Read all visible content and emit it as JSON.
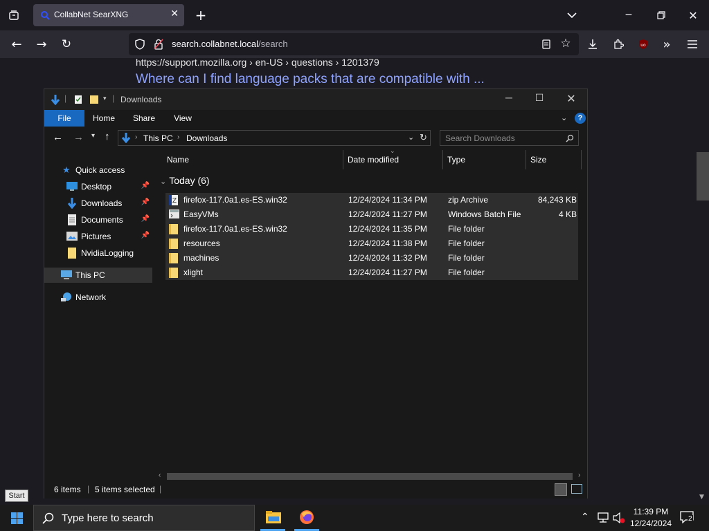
{
  "browser": {
    "tab_title": "CollabNet SearXNG",
    "url_host": "search.collabnet.local",
    "url_path": "/search"
  },
  "page": {
    "result_url": "https://support.mozilla.org  › en-US › questions › 1201379",
    "result_title": "Where can I find language packs that are compatible with ..."
  },
  "tooltip": {
    "start": "Start"
  },
  "explorer": {
    "title": "Downloads",
    "ribbon": {
      "file": "File",
      "home": "Home",
      "share": "Share",
      "view": "View"
    },
    "breadcrumb": {
      "this_pc": "This PC",
      "downloads": "Downloads"
    },
    "search_placeholder": "Search Downloads",
    "nav": {
      "quick_access": "Quick access",
      "desktop": "Desktop",
      "downloads": "Downloads",
      "documents": "Documents",
      "pictures": "Pictures",
      "nvidia": "NvidiaLogging",
      "this_pc": "This PC",
      "network": "Network"
    },
    "columns": {
      "name": "Name",
      "date": "Date modified",
      "type": "Type",
      "size": "Size"
    },
    "group": "Today (6)",
    "files": [
      {
        "name": "firefox-117.0a1.es-ES.win32",
        "date": "12/24/2024 11:34 PM",
        "type": "zip Archive",
        "size": "84,243 KB",
        "icon": "zip-icon"
      },
      {
        "name": "EasyVMs",
        "date": "12/24/2024 11:27 PM",
        "type": "Windows Batch File",
        "size": "4 KB",
        "icon": "batch-file-icon"
      },
      {
        "name": "firefox-117.0a1.es-ES.win32",
        "date": "12/24/2024 11:35 PM",
        "type": "File folder",
        "size": "",
        "icon": "folder-icon"
      },
      {
        "name": "resources",
        "date": "12/24/2024 11:38 PM",
        "type": "File folder",
        "size": "",
        "icon": "folder-icon"
      },
      {
        "name": "machines",
        "date": "12/24/2024 11:32 PM",
        "type": "File folder",
        "size": "",
        "icon": "folder-icon"
      },
      {
        "name": "xlight",
        "date": "12/24/2024 11:27 PM",
        "type": "File folder",
        "size": "",
        "icon": "folder-icon"
      }
    ],
    "status": {
      "items": "6 items",
      "selected": "5 items selected"
    }
  },
  "taskbar": {
    "search_placeholder": "Type here to search",
    "time": "11:39 PM",
    "date": "12/24/2024",
    "notifications": "2"
  },
  "colors": {
    "accent": "#1a69c0",
    "link": "#8fa3ff",
    "folder": "#f8d775"
  }
}
